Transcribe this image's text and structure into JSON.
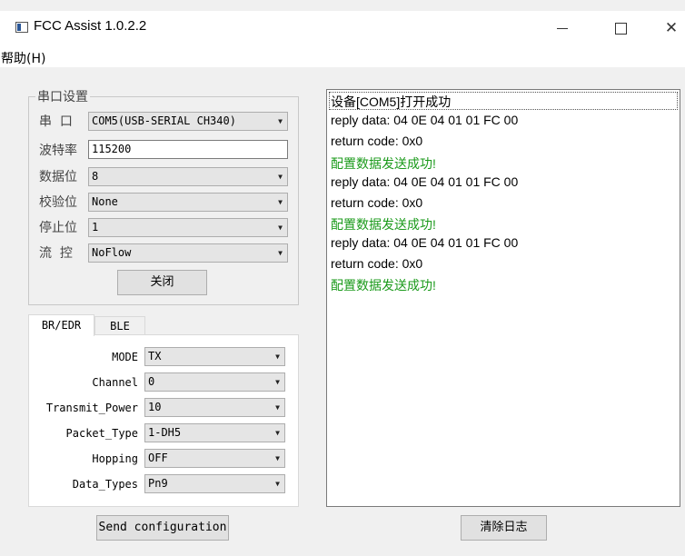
{
  "window": {
    "title": "FCC Assist 1.0.2.2"
  },
  "menu": {
    "help": "帮助(H)"
  },
  "serial": {
    "group_title": "串口设置",
    "port_label": "串  口",
    "port_value": "COM5(USB-SERIAL CH340)",
    "baud_label": "波特率",
    "baud_value": "115200",
    "databits_label": "数据位",
    "databits_value": "8",
    "parity_label": "校验位",
    "parity_value": "None",
    "stopbits_label": "停止位",
    "stopbits_value": "1",
    "flow_label": "流  控",
    "flow_value": "NoFlow",
    "close_button": "关闭"
  },
  "tabs": {
    "bredr": "BR/EDR",
    "ble": "BLE"
  },
  "config": {
    "mode_label": "MODE",
    "mode_value": "TX",
    "channel_label": "Channel",
    "channel_value": "0",
    "power_label": "Transmit_Power",
    "power_value": "10",
    "packet_label": "Packet_Type",
    "packet_value": "1-DH5",
    "hopping_label": "Hopping",
    "hopping_value": "OFF",
    "datatypes_label": "Data_Types",
    "datatypes_value": "Pn9"
  },
  "send_button": "Send configuration",
  "clear_button": "清除日志",
  "log": [
    "设备[COM5]打开成功",
    "reply data: 04 0E 04 01 01 FC 00",
    "return code: 0x0",
    "配置数据发送成功!",
    "reply data: 04 0E 04 01 01 FC 00",
    "return code: 0x0",
    "配置数据发送成功!",
    "reply data: 04 0E 04 01 01 FC 00",
    "return code: 0x0",
    "配置数据发送成功!"
  ],
  "colors": {
    "success": "#1a9a1a"
  }
}
